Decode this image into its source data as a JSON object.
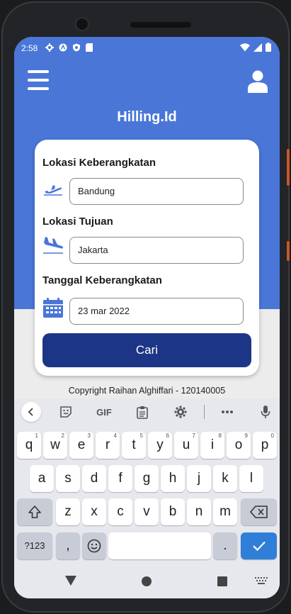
{
  "status": {
    "time": "2:58"
  },
  "app": {
    "title": "Hilling.Id"
  },
  "form": {
    "origin_label": "Lokasi Keberangkatan",
    "origin_value": "Bandung",
    "destination_label": "Lokasi Tujuan",
    "destination_value": "Jakarta",
    "date_label": "Tanggal Keberangkatan",
    "date_value": "23 mar 2022",
    "search_button": "Cari"
  },
  "footer": {
    "copyright": "Copyright Raihan Alghiffari - 120140005"
  },
  "keyboard": {
    "toolbar": {
      "gif_label": "GIF"
    },
    "row1": [
      {
        "key": "q",
        "num": "1"
      },
      {
        "key": "w",
        "num": "2"
      },
      {
        "key": "e",
        "num": "3"
      },
      {
        "key": "r",
        "num": "4"
      },
      {
        "key": "t",
        "num": "5"
      },
      {
        "key": "y",
        "num": "6"
      },
      {
        "key": "u",
        "num": "7"
      },
      {
        "key": "i",
        "num": "8"
      },
      {
        "key": "o",
        "num": "9"
      },
      {
        "key": "p",
        "num": "0"
      }
    ],
    "row2": [
      "a",
      "s",
      "d",
      "f",
      "g",
      "h",
      "j",
      "k",
      "l"
    ],
    "row3": [
      "z",
      "x",
      "c",
      "v",
      "b",
      "n",
      "m"
    ],
    "symbols_key": "?123",
    "comma_key": ",",
    "period_key": "."
  },
  "colors": {
    "header_blue": "#4a76d8",
    "button_navy": "#1d3586",
    "enter_blue": "#2f7fd8"
  }
}
